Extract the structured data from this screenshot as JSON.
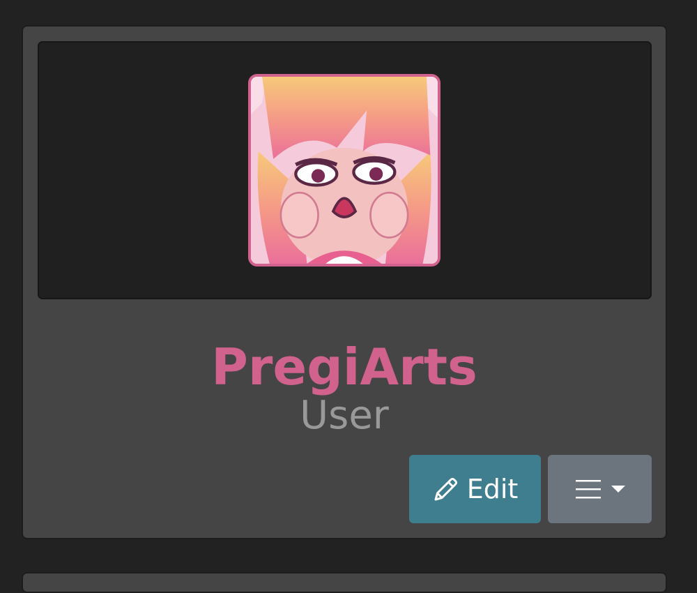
{
  "profile": {
    "username": "PregiArts",
    "role": "User",
    "username_color": "#d0628d",
    "role_color": "#999999"
  },
  "actions": {
    "edit": {
      "label": "Edit",
      "icon": "pencil-icon",
      "color": "#3e7e8f"
    },
    "menu": {
      "icon": "hamburger-menu-icon",
      "caret_icon": "caret-down-icon",
      "color": "#6c757d"
    }
  }
}
